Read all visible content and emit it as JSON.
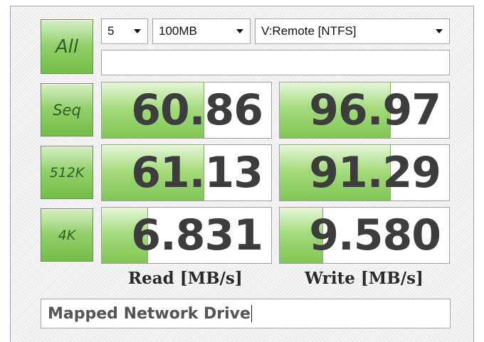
{
  "buttons": {
    "all": "All",
    "seq": "Seq",
    "k512": "512K",
    "k4": "4K"
  },
  "settings": {
    "runs": "5",
    "size": "100MB",
    "drive": "V:Remote [NTFS]"
  },
  "results": {
    "seq": {
      "read": "60.86",
      "write": "96.97",
      "read_fill": 0.6,
      "write_fill": 0.65
    },
    "k512": {
      "read": "61.13",
      "write": "91.29",
      "read_fill": 0.6,
      "write_fill": 0.65
    },
    "k4": {
      "read": "6.831",
      "write": "9.580",
      "read_fill": 0.27,
      "write_fill": 0.25
    }
  },
  "labels": {
    "read": "Read [MB/s]",
    "write": "Write [MB/s]"
  },
  "status_text": "Mapped Network Drive",
  "colors": {
    "button_green": "#8fcf68",
    "bar_green": "#a6dc7f",
    "value_text": "#3d3d3d"
  }
}
